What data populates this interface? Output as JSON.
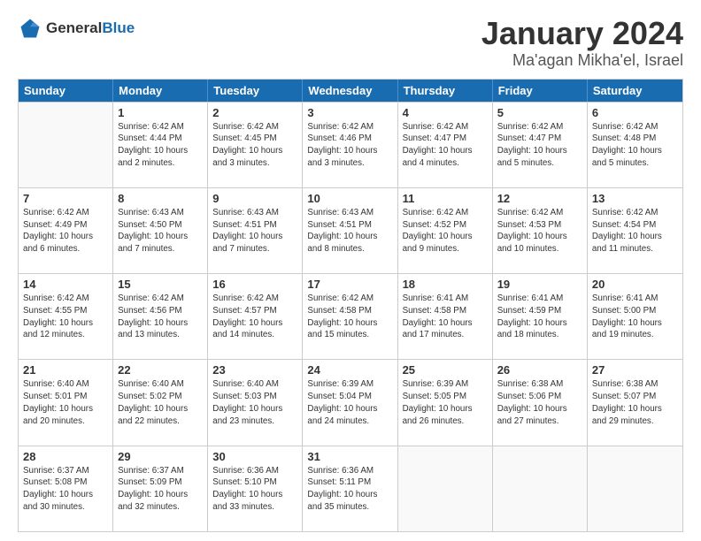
{
  "header": {
    "logo_general": "General",
    "logo_blue": "Blue",
    "month_title": "January 2024",
    "location": "Ma'agan Mikha'el, Israel"
  },
  "calendar": {
    "days_of_week": [
      "Sunday",
      "Monday",
      "Tuesday",
      "Wednesday",
      "Thursday",
      "Friday",
      "Saturday"
    ],
    "rows": [
      [
        {
          "day": "",
          "sunrise": "",
          "sunset": "",
          "daylight": ""
        },
        {
          "day": "1",
          "sunrise": "Sunrise: 6:42 AM",
          "sunset": "Sunset: 4:44 PM",
          "daylight": "Daylight: 10 hours and 2 minutes."
        },
        {
          "day": "2",
          "sunrise": "Sunrise: 6:42 AM",
          "sunset": "Sunset: 4:45 PM",
          "daylight": "Daylight: 10 hours and 3 minutes."
        },
        {
          "day": "3",
          "sunrise": "Sunrise: 6:42 AM",
          "sunset": "Sunset: 4:46 PM",
          "daylight": "Daylight: 10 hours and 3 minutes."
        },
        {
          "day": "4",
          "sunrise": "Sunrise: 6:42 AM",
          "sunset": "Sunset: 4:47 PM",
          "daylight": "Daylight: 10 hours and 4 minutes."
        },
        {
          "day": "5",
          "sunrise": "Sunrise: 6:42 AM",
          "sunset": "Sunset: 4:47 PM",
          "daylight": "Daylight: 10 hours and 5 minutes."
        },
        {
          "day": "6",
          "sunrise": "Sunrise: 6:42 AM",
          "sunset": "Sunset: 4:48 PM",
          "daylight": "Daylight: 10 hours and 5 minutes."
        }
      ],
      [
        {
          "day": "7",
          "sunrise": "Sunrise: 6:42 AM",
          "sunset": "Sunset: 4:49 PM",
          "daylight": "Daylight: 10 hours and 6 minutes."
        },
        {
          "day": "8",
          "sunrise": "Sunrise: 6:43 AM",
          "sunset": "Sunset: 4:50 PM",
          "daylight": "Daylight: 10 hours and 7 minutes."
        },
        {
          "day": "9",
          "sunrise": "Sunrise: 6:43 AM",
          "sunset": "Sunset: 4:51 PM",
          "daylight": "Daylight: 10 hours and 7 minutes."
        },
        {
          "day": "10",
          "sunrise": "Sunrise: 6:43 AM",
          "sunset": "Sunset: 4:51 PM",
          "daylight": "Daylight: 10 hours and 8 minutes."
        },
        {
          "day": "11",
          "sunrise": "Sunrise: 6:42 AM",
          "sunset": "Sunset: 4:52 PM",
          "daylight": "Daylight: 10 hours and 9 minutes."
        },
        {
          "day": "12",
          "sunrise": "Sunrise: 6:42 AM",
          "sunset": "Sunset: 4:53 PM",
          "daylight": "Daylight: 10 hours and 10 minutes."
        },
        {
          "day": "13",
          "sunrise": "Sunrise: 6:42 AM",
          "sunset": "Sunset: 4:54 PM",
          "daylight": "Daylight: 10 hours and 11 minutes."
        }
      ],
      [
        {
          "day": "14",
          "sunrise": "Sunrise: 6:42 AM",
          "sunset": "Sunset: 4:55 PM",
          "daylight": "Daylight: 10 hours and 12 minutes."
        },
        {
          "day": "15",
          "sunrise": "Sunrise: 6:42 AM",
          "sunset": "Sunset: 4:56 PM",
          "daylight": "Daylight: 10 hours and 13 minutes."
        },
        {
          "day": "16",
          "sunrise": "Sunrise: 6:42 AM",
          "sunset": "Sunset: 4:57 PM",
          "daylight": "Daylight: 10 hours and 14 minutes."
        },
        {
          "day": "17",
          "sunrise": "Sunrise: 6:42 AM",
          "sunset": "Sunset: 4:58 PM",
          "daylight": "Daylight: 10 hours and 15 minutes."
        },
        {
          "day": "18",
          "sunrise": "Sunrise: 6:41 AM",
          "sunset": "Sunset: 4:58 PM",
          "daylight": "Daylight: 10 hours and 17 minutes."
        },
        {
          "day": "19",
          "sunrise": "Sunrise: 6:41 AM",
          "sunset": "Sunset: 4:59 PM",
          "daylight": "Daylight: 10 hours and 18 minutes."
        },
        {
          "day": "20",
          "sunrise": "Sunrise: 6:41 AM",
          "sunset": "Sunset: 5:00 PM",
          "daylight": "Daylight: 10 hours and 19 minutes."
        }
      ],
      [
        {
          "day": "21",
          "sunrise": "Sunrise: 6:40 AM",
          "sunset": "Sunset: 5:01 PM",
          "daylight": "Daylight: 10 hours and 20 minutes."
        },
        {
          "day": "22",
          "sunrise": "Sunrise: 6:40 AM",
          "sunset": "Sunset: 5:02 PM",
          "daylight": "Daylight: 10 hours and 22 minutes."
        },
        {
          "day": "23",
          "sunrise": "Sunrise: 6:40 AM",
          "sunset": "Sunset: 5:03 PM",
          "daylight": "Daylight: 10 hours and 23 minutes."
        },
        {
          "day": "24",
          "sunrise": "Sunrise: 6:39 AM",
          "sunset": "Sunset: 5:04 PM",
          "daylight": "Daylight: 10 hours and 24 minutes."
        },
        {
          "day": "25",
          "sunrise": "Sunrise: 6:39 AM",
          "sunset": "Sunset: 5:05 PM",
          "daylight": "Daylight: 10 hours and 26 minutes."
        },
        {
          "day": "26",
          "sunrise": "Sunrise: 6:38 AM",
          "sunset": "Sunset: 5:06 PM",
          "daylight": "Daylight: 10 hours and 27 minutes."
        },
        {
          "day": "27",
          "sunrise": "Sunrise: 6:38 AM",
          "sunset": "Sunset: 5:07 PM",
          "daylight": "Daylight: 10 hours and 29 minutes."
        }
      ],
      [
        {
          "day": "28",
          "sunrise": "Sunrise: 6:37 AM",
          "sunset": "Sunset: 5:08 PM",
          "daylight": "Daylight: 10 hours and 30 minutes."
        },
        {
          "day": "29",
          "sunrise": "Sunrise: 6:37 AM",
          "sunset": "Sunset: 5:09 PM",
          "daylight": "Daylight: 10 hours and 32 minutes."
        },
        {
          "day": "30",
          "sunrise": "Sunrise: 6:36 AM",
          "sunset": "Sunset: 5:10 PM",
          "daylight": "Daylight: 10 hours and 33 minutes."
        },
        {
          "day": "31",
          "sunrise": "Sunrise: 6:36 AM",
          "sunset": "Sunset: 5:11 PM",
          "daylight": "Daylight: 10 hours and 35 minutes."
        },
        {
          "day": "",
          "sunrise": "",
          "sunset": "",
          "daylight": ""
        },
        {
          "day": "",
          "sunrise": "",
          "sunset": "",
          "daylight": ""
        },
        {
          "day": "",
          "sunrise": "",
          "sunset": "",
          "daylight": ""
        }
      ]
    ]
  }
}
